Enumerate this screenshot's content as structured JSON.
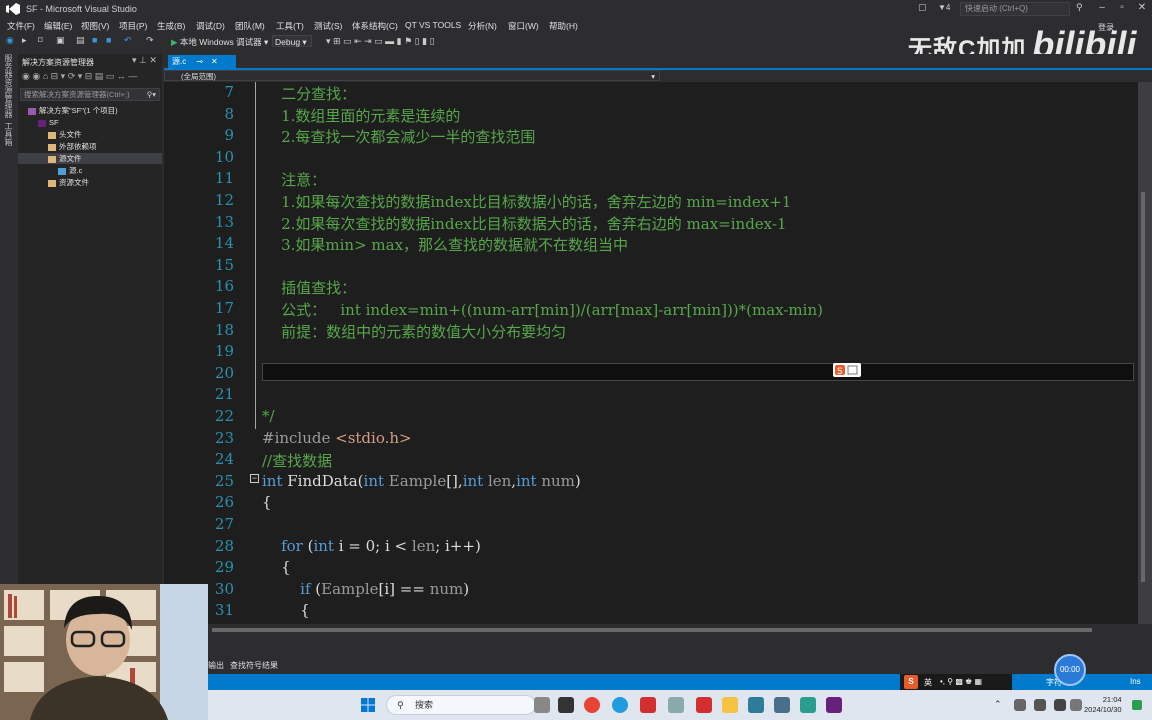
{
  "window": {
    "title": "SF - Microsoft Visual Studio",
    "quick_launch_placeholder": "快速启动 (Ctrl+Q)",
    "notification_count": "4",
    "login_label": "登录"
  },
  "menu": [
    "文件(F)",
    "编辑(E)",
    "视图(V)",
    "项目(P)",
    "生成(B)",
    "调试(D)",
    "团队(M)",
    "工具(T)",
    "测试(S)",
    "体系结构(C)",
    "QT VS TOOLS",
    "分析(N)",
    "窗口(W)",
    "帮助(H)"
  ],
  "toolbar": {
    "run_label": "本地 Windows 调试器",
    "config": "Debug"
  },
  "watermark": {
    "text": "无敌C加加",
    "brand": "bilibili"
  },
  "left_strip": {
    "items": [
      "服务器资源管理器",
      "工具箱"
    ]
  },
  "solution_explorer": {
    "title": "解决方案资源管理器",
    "search_placeholder": "搜索解决方案资源管理器(Ctrl+;)",
    "tree": [
      {
        "label": "解决方案\"SF\"(1 个项目)",
        "indent": 0,
        "icon": "solution-icon"
      },
      {
        "label": "SF",
        "indent": 1,
        "icon": "project-icon"
      },
      {
        "label": "头文件",
        "indent": 2,
        "icon": "folder-icon"
      },
      {
        "label": "外部依赖项",
        "indent": 2,
        "icon": "folder-icon"
      },
      {
        "label": "源文件",
        "indent": 2,
        "icon": "folder-icon",
        "selected": true
      },
      {
        "label": "源.c",
        "indent": 3,
        "icon": "c-file-icon"
      },
      {
        "label": "资源文件",
        "indent": 2,
        "icon": "folder-icon"
      }
    ]
  },
  "document": {
    "tab_label": "源.c",
    "scope": "(全局范围)"
  },
  "code_lines": [
    {
      "n": "7",
      "spans": [
        {
          "c": "cmt",
          "t": "    二分查找："
        }
      ]
    },
    {
      "n": "8",
      "spans": [
        {
          "c": "cmt",
          "t": "    1.数组里面的元素是连续的"
        }
      ]
    },
    {
      "n": "9",
      "spans": [
        {
          "c": "cmt",
          "t": "    2.每查找一次都会减少一半的查找范围"
        }
      ]
    },
    {
      "n": "10",
      "spans": []
    },
    {
      "n": "11",
      "spans": [
        {
          "c": "cmt",
          "t": "    注意："
        }
      ]
    },
    {
      "n": "12",
      "spans": [
        {
          "c": "cmt",
          "t": "    1.如果每次查找的数据index比目标数据小的话，舍弃左边的 min=index+1"
        }
      ]
    },
    {
      "n": "13",
      "spans": [
        {
          "c": "cmt",
          "t": "    2.如果每次查找的数据index比目标数据大的话，舍弃右边的 max=index-1"
        }
      ]
    },
    {
      "n": "14",
      "spans": [
        {
          "c": "cmt",
          "t": "    3.如果min> max，那么查找的数据就不在数组当中"
        }
      ]
    },
    {
      "n": "15",
      "spans": []
    },
    {
      "n": "16",
      "spans": [
        {
          "c": "cmt",
          "t": "    插值查找："
        }
      ]
    },
    {
      "n": "17",
      "spans": [
        {
          "c": "cmt",
          "t": "    公式：   int index=min+((num-arr[min])/(arr[max]-arr[min]))*(max-min)"
        }
      ]
    },
    {
      "n": "18",
      "spans": [
        {
          "c": "cmt",
          "t": "    前提：数组中的元素的数值大小分布要均匀"
        }
      ]
    },
    {
      "n": "19",
      "spans": []
    },
    {
      "n": "20",
      "spans": []
    },
    {
      "n": "21",
      "spans": []
    },
    {
      "n": "22",
      "spans": [
        {
          "c": "cmt",
          "t": "*/"
        }
      ]
    },
    {
      "n": "23",
      "spans": [
        {
          "c": "pp",
          "t": "#include "
        },
        {
          "c": "str",
          "t": "<stdio.h>"
        }
      ]
    },
    {
      "n": "24",
      "spans": [
        {
          "c": "cmt",
          "t": "//查找数据"
        }
      ]
    },
    {
      "n": "25",
      "spans": [
        {
          "c": "kw",
          "t": "int"
        },
        {
          "c": "id",
          "t": " FindData("
        },
        {
          "c": "kw",
          "t": "int"
        },
        {
          "c": "par",
          "t": " Eample"
        },
        {
          "c": "id",
          "t": "[],"
        },
        {
          "c": "kw",
          "t": "int"
        },
        {
          "c": "par",
          "t": " len"
        },
        {
          "c": "id",
          "t": ","
        },
        {
          "c": "kw",
          "t": "int"
        },
        {
          "c": "par",
          "t": " num"
        },
        {
          "c": "id",
          "t": ")"
        }
      ]
    },
    {
      "n": "26",
      "spans": [
        {
          "c": "id",
          "t": "{"
        }
      ]
    },
    {
      "n": "27",
      "spans": []
    },
    {
      "n": "28",
      "spans": [
        {
          "c": "kw",
          "t": "    for"
        },
        {
          "c": "id",
          "t": " ("
        },
        {
          "c": "kw",
          "t": "int"
        },
        {
          "c": "id",
          "t": " i = 0; i < "
        },
        {
          "c": "par",
          "t": "len"
        },
        {
          "c": "id",
          "t": "; i++)"
        }
      ]
    },
    {
      "n": "29",
      "spans": [
        {
          "c": "id",
          "t": "    {"
        }
      ]
    },
    {
      "n": "30",
      "spans": [
        {
          "c": "kw",
          "t": "        if"
        },
        {
          "c": "id",
          "t": " ("
        },
        {
          "c": "par",
          "t": "Eample"
        },
        {
          "c": "id",
          "t": "[i] == "
        },
        {
          "c": "par",
          "t": "num"
        },
        {
          "c": "id",
          "t": ")"
        }
      ]
    },
    {
      "n": "31",
      "spans": [
        {
          "c": "id",
          "t": "        {"
        }
      ]
    }
  ],
  "output_tabs": [
    "输出",
    "查找符号结果"
  ],
  "status": {
    "zoom_hint": "字符",
    "ins": "Ins"
  },
  "timer": "00:00",
  "taskbar": {
    "search_label": "搜索",
    "ime_lang": "英",
    "time": "21:04",
    "date": "2024/10/30"
  },
  "colors": {
    "accent": "#007acc",
    "comment": "#57a64a",
    "keyword": "#569cd6",
    "line_number": "#2b91af"
  }
}
